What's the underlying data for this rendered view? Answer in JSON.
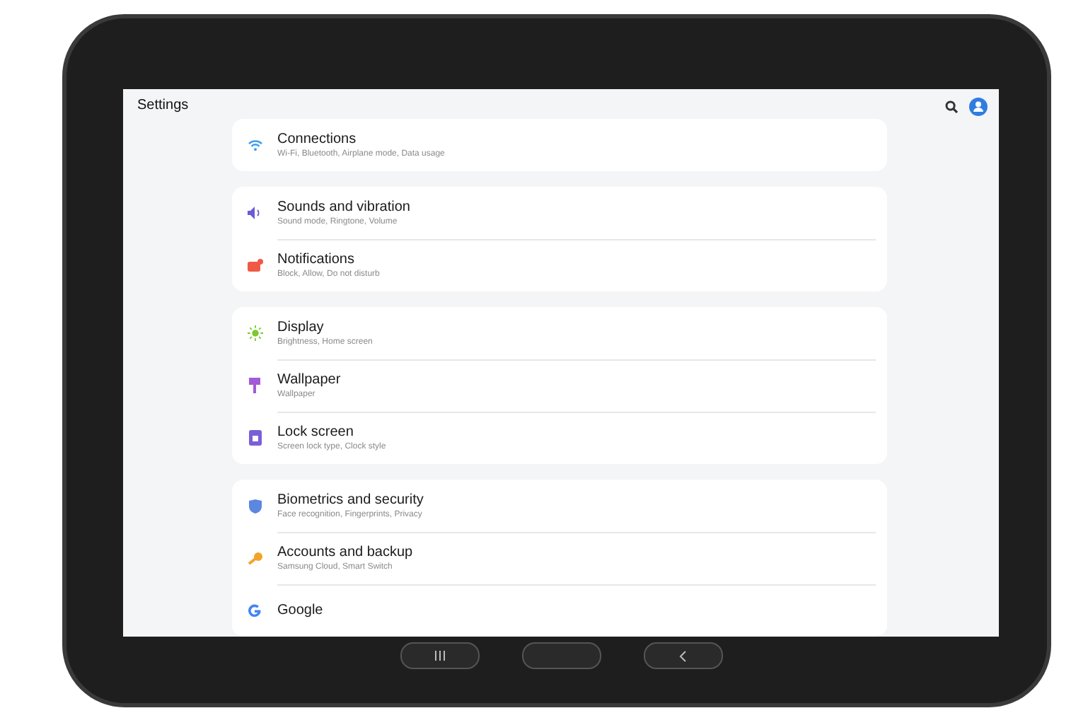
{
  "screen": {
    "title": "Settings"
  },
  "groups": [
    {
      "items": [
        {
          "title": "Connections",
          "subtitle": "Wi-Fi, Bluetooth, Airplane mode, Data usage"
        }
      ]
    },
    {
      "items": [
        {
          "title": "Sounds and vibration",
          "subtitle": "Sound mode, Ringtone, Volume"
        },
        {
          "title": "Notifications",
          "subtitle": "Block, Allow, Do not disturb"
        }
      ]
    },
    {
      "items": [
        {
          "title": "Display",
          "subtitle": "Brightness, Home screen"
        },
        {
          "title": "Wallpaper",
          "subtitle": "Wallpaper"
        },
        {
          "title": "Lock screen",
          "subtitle": "Screen lock type, Clock style"
        }
      ]
    },
    {
      "items": [
        {
          "title": "Biometrics and security",
          "subtitle": "Face recognition, Fingerprints, Privacy"
        },
        {
          "title": "Accounts and backup",
          "subtitle": "Samsung Cloud, Smart Switch"
        },
        {
          "title": "Google"
        }
      ]
    }
  ]
}
